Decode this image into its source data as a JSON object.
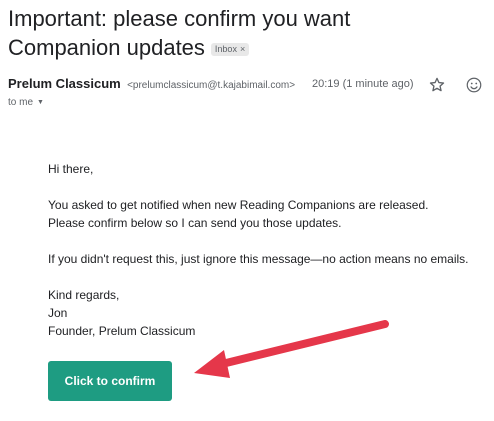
{
  "email": {
    "subject": "Important: please confirm you want Companion updates",
    "label": "Inbox",
    "label_close": "×",
    "sender_name": "Prelum Classicum",
    "sender_email": "<prelumclassicum@t.kajabimail.com>",
    "timestamp": "20:19 (1 minute ago)",
    "to": "to me",
    "to_caret": "▼",
    "greeting": "Hi there,",
    "para1_line1": "You asked to get notified when new Reading Companions are released.",
    "para1_line2": "Please confirm below so I can send you those updates.",
    "para2": "If you didn't request this, just ignore this message—no action means no emails.",
    "signoff": "Kind regards,",
    "signer": "Jon",
    "signer_title": "Founder, Prelum Classicum",
    "cta_label": "Click to confirm"
  },
  "icons": {
    "star": "star-icon",
    "emoji": "emoji-icon"
  },
  "colors": {
    "cta_bg": "#1e9c82",
    "arrow": "#e5374a"
  }
}
